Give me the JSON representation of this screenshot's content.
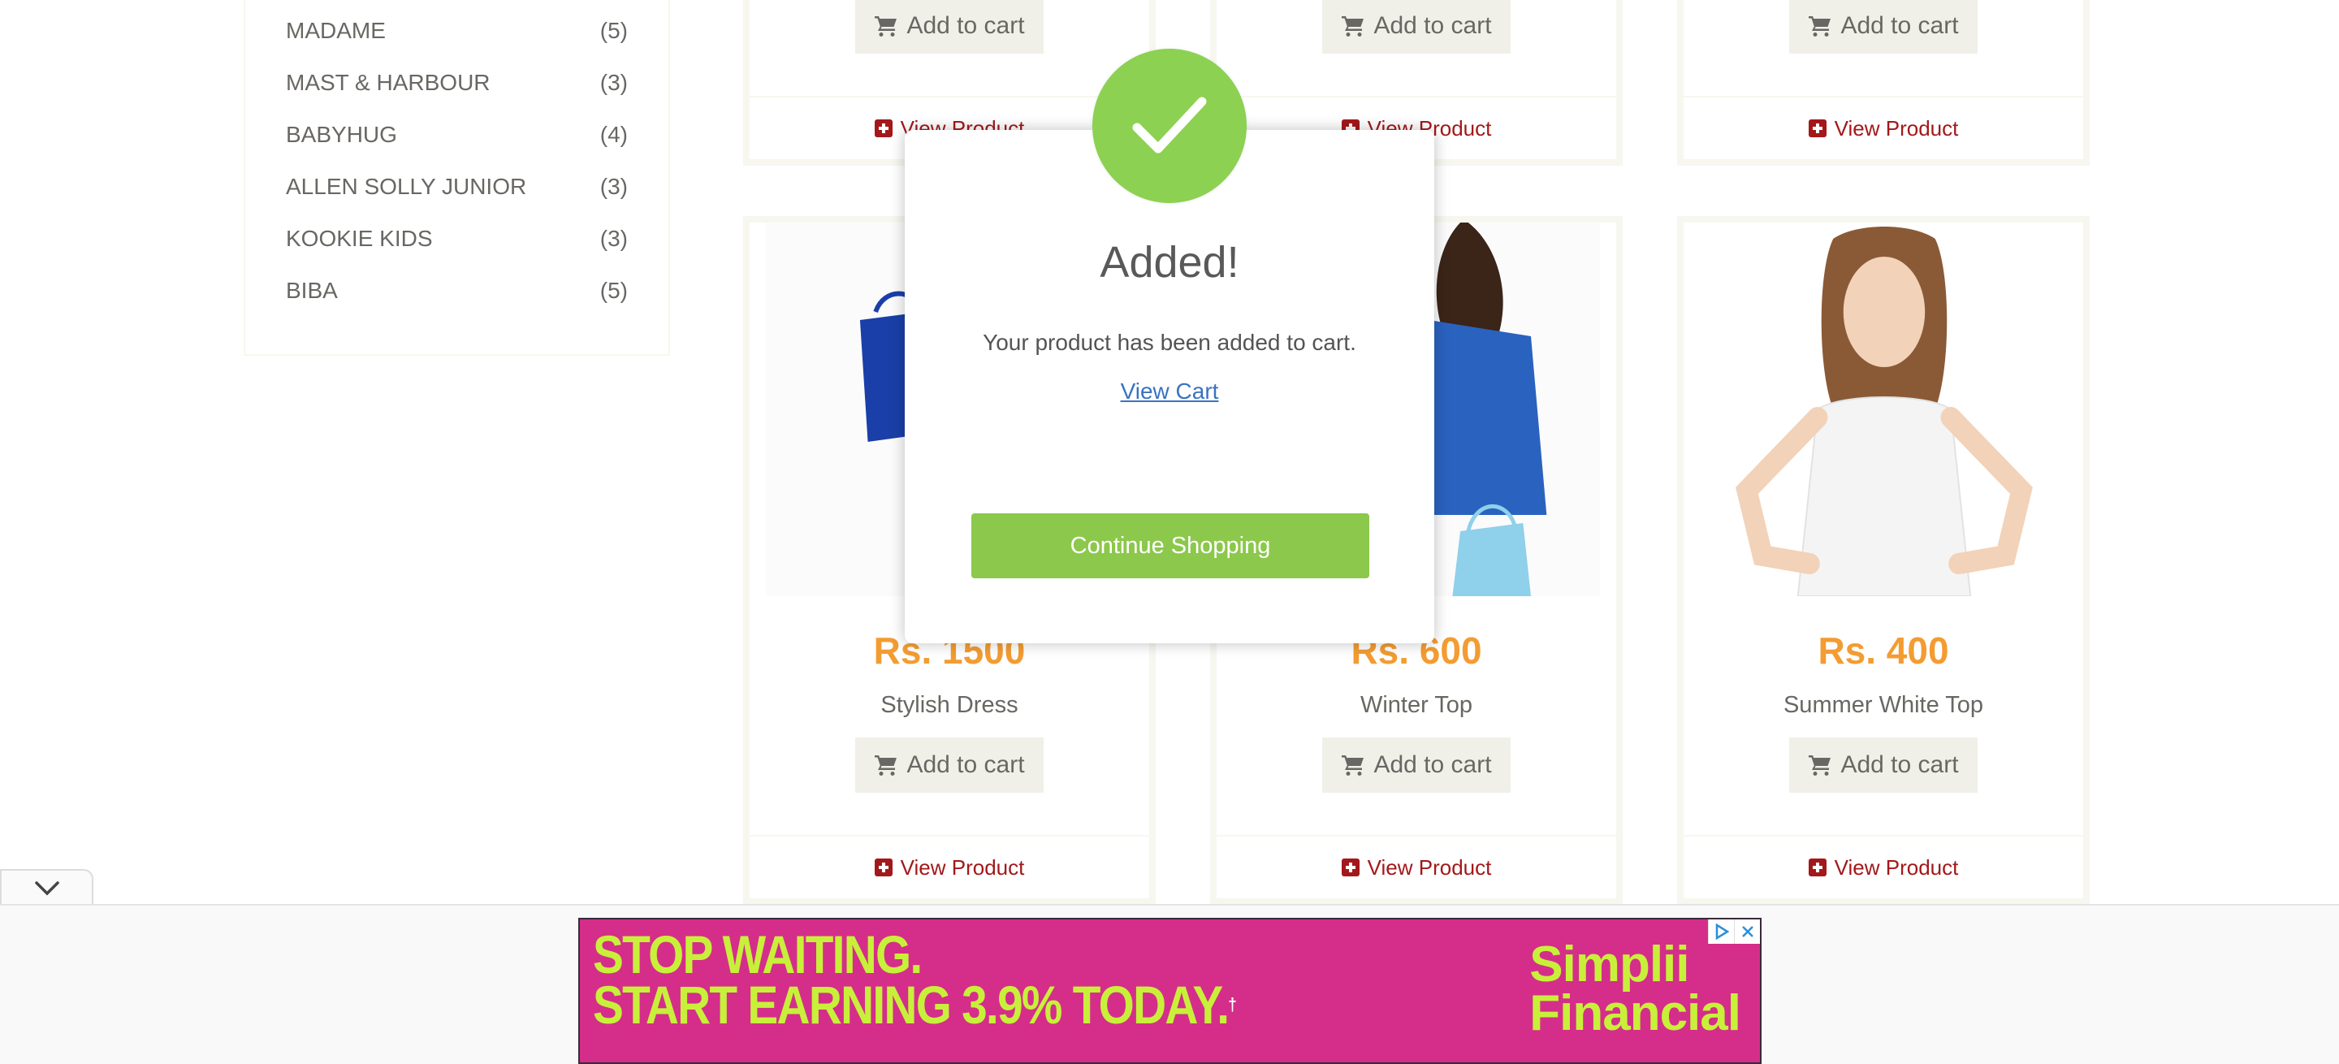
{
  "brands": [
    {
      "name": "MADAME",
      "count": "(5)"
    },
    {
      "name": "MAST & HARBOUR",
      "count": "(3)"
    },
    {
      "name": "BABYHUG",
      "count": "(4)"
    },
    {
      "name": "ALLEN SOLLY JUNIOR",
      "count": "(3)"
    },
    {
      "name": "KOOKIE KIDS",
      "count": "(3)"
    },
    {
      "name": "BIBA",
      "count": "(5)"
    }
  ],
  "top_cards": [
    {
      "cart_label": "Add to cart",
      "view_label": "View Product"
    },
    {
      "cart_label": "Add to cart",
      "view_label": "View Product"
    },
    {
      "cart_label": "Add to cart",
      "view_label": "View Product"
    }
  ],
  "products": [
    {
      "price": "Rs. 1500",
      "name": "Stylish Dress",
      "cart_label": "Add to cart",
      "view_label": "View Product"
    },
    {
      "price": "Rs. 600",
      "name": "Winter Top",
      "cart_label": "Add to cart",
      "view_label": "View Product"
    },
    {
      "price": "Rs. 400",
      "name": "Summer White Top",
      "cart_label": "Add to cart",
      "view_label": "View Product"
    }
  ],
  "modal": {
    "title": "Added!",
    "message": "Your product has been added to cart.",
    "link": "View Cart",
    "button": "Continue Shopping"
  },
  "ad": {
    "line1": "STOP WAITING.",
    "line2": "START EARNING 3.9% TODAY.",
    "dagger": "†",
    "brand_line1": "Simplii",
    "brand_line2": "Financial"
  },
  "colors": {
    "accent_green": "#8cd152",
    "price_orange": "#f39c32",
    "link_red": "#a3181a",
    "ad_pink": "#d42e8a",
    "ad_lime": "#c8f03a"
  }
}
